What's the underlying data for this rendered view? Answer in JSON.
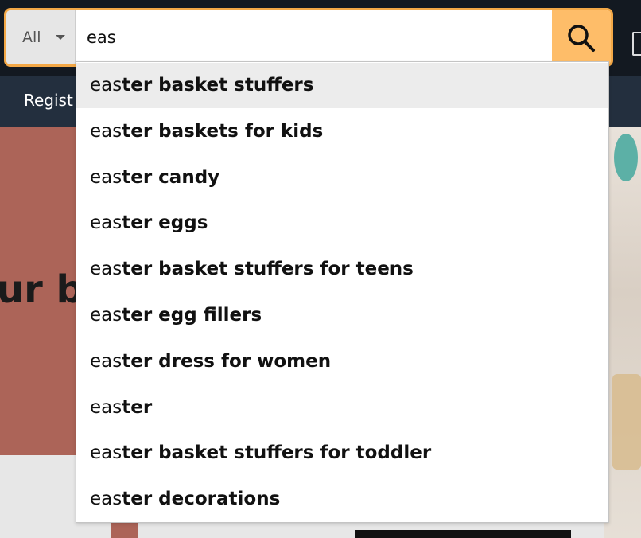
{
  "search": {
    "department": "All",
    "query": "eas",
    "search_icon": "search-icon",
    "caret_icon": "caret-down-icon"
  },
  "nav": {
    "registry_link": "Regist"
  },
  "hero": {
    "heading": "ur b"
  },
  "suggestions": [
    {
      "prefix": "eas",
      "rest": "ter basket stuffers",
      "highlighted": true
    },
    {
      "prefix": "eas",
      "rest": "ter baskets for kids"
    },
    {
      "prefix": "eas",
      "rest": "ter candy"
    },
    {
      "prefix": "eas",
      "rest": "ter eggs"
    },
    {
      "prefix": "eas",
      "rest": "ter basket stuffers for teens"
    },
    {
      "prefix": "eas",
      "rest": "ter egg fillers"
    },
    {
      "prefix": "eas",
      "rest": "ter dress for women"
    },
    {
      "prefix": "eas",
      "rest": "ter"
    },
    {
      "prefix": "eas",
      "rest": "ter basket stuffers for toddler"
    },
    {
      "prefix": "eas",
      "rest": "ter decorations"
    }
  ],
  "colors": {
    "search_border": "#f3a847",
    "search_button": "#febd69",
    "nav_dark": "#131921",
    "nav_secondary": "#232f3e",
    "hero_bg": "#ac6458",
    "highlight_row": "#ececec"
  }
}
